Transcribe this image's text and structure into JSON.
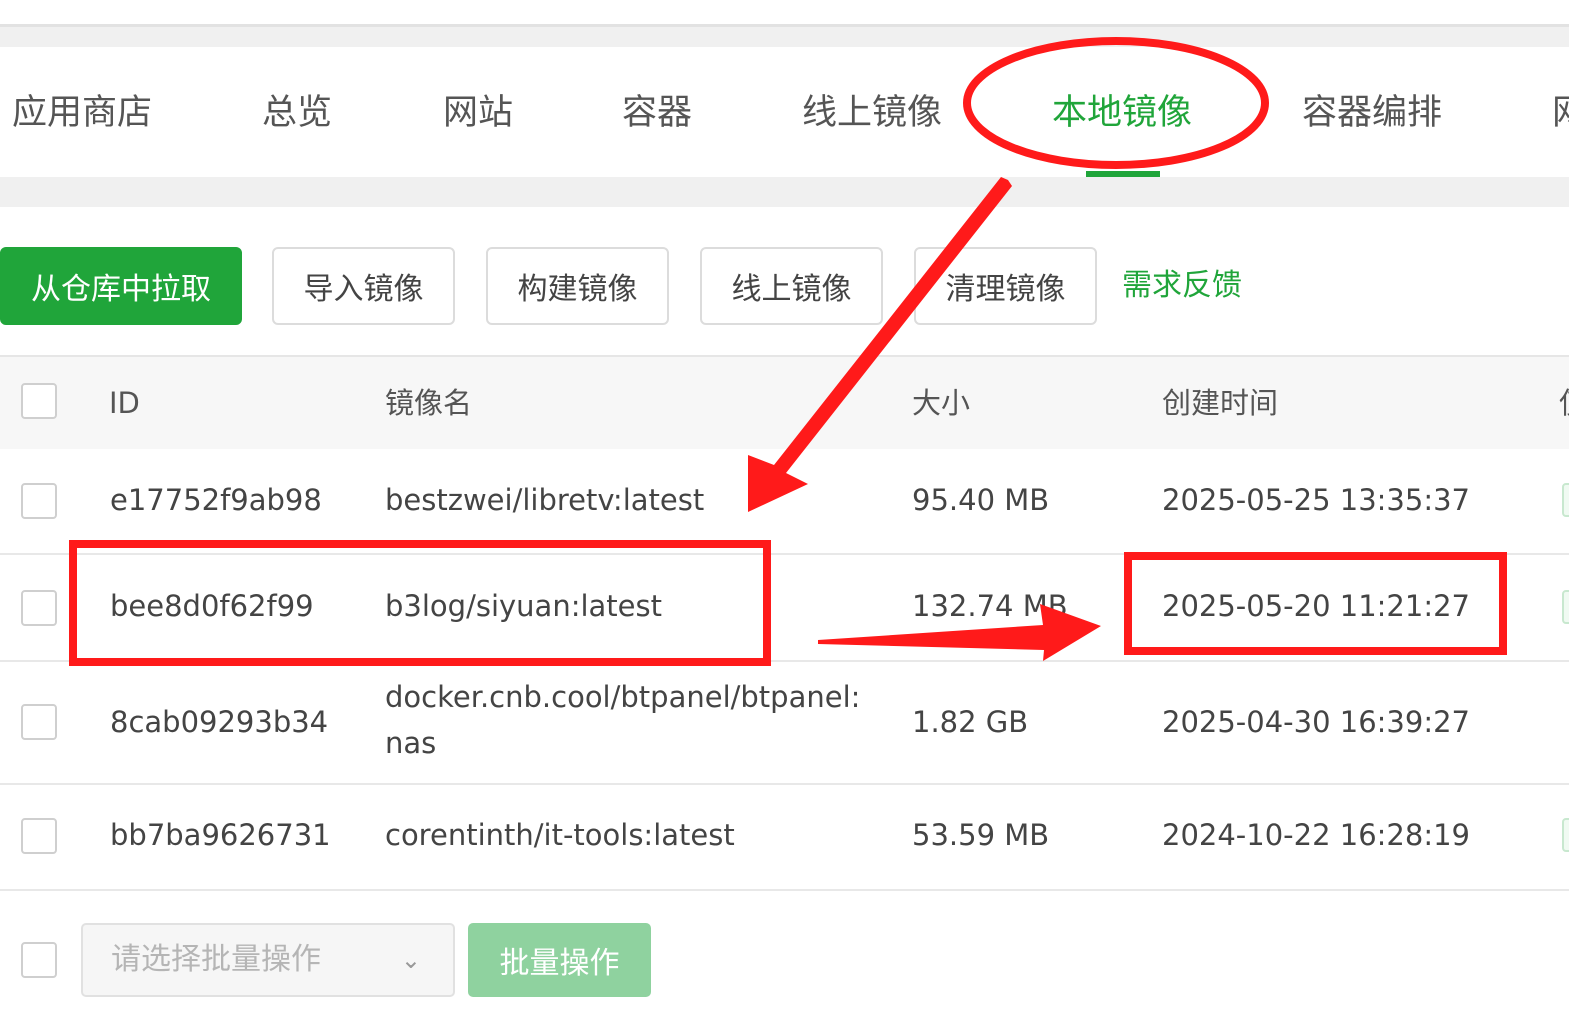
{
  "tabs": [
    {
      "label": "应用商店"
    },
    {
      "label": "总览"
    },
    {
      "label": "网站"
    },
    {
      "label": "容器"
    },
    {
      "label": "线上镜像"
    },
    {
      "label": "本地镜像",
      "active": true
    },
    {
      "label": "容器编排"
    },
    {
      "label": "网"
    }
  ],
  "toolbar": {
    "pull_label": "从仓库中拉取",
    "import_label": "导入镜像",
    "build_label": "构建镜像",
    "online_label": "线上镜像",
    "clean_label": "清理镜像",
    "feedback_label": "需求反馈"
  },
  "table": {
    "headers": {
      "id": "ID",
      "name": "镜像名",
      "size": "大小",
      "created": "创建时间",
      "more": "使"
    },
    "rows": [
      {
        "id": "e17752f9ab98",
        "name": "bestzwei/libretv:latest",
        "size": "95.40 MB",
        "created": "2025-05-25 13:35:37"
      },
      {
        "id": "bee8d0f62f99",
        "name": "b3log/siyuan:latest",
        "size": "132.74 MB",
        "created": "2025-05-20 11:21:27"
      },
      {
        "id": "8cab09293b34",
        "name": "docker.cnb.cool/btpanel/btpanel:",
        "name_line2": "nas",
        "size": "1.82 GB",
        "created": "2025-04-30 16:39:27"
      },
      {
        "id": "bb7ba9626731",
        "name": "corentinth/it-tools:latest",
        "size": "53.59 MB",
        "created": "2024-10-22 16:28:19"
      }
    ]
  },
  "batch": {
    "select_placeholder": "请选择批量操作",
    "button_label": "批量操作"
  },
  "colors": {
    "accent": "#20a53a",
    "annotation": "#ff1a1a"
  }
}
